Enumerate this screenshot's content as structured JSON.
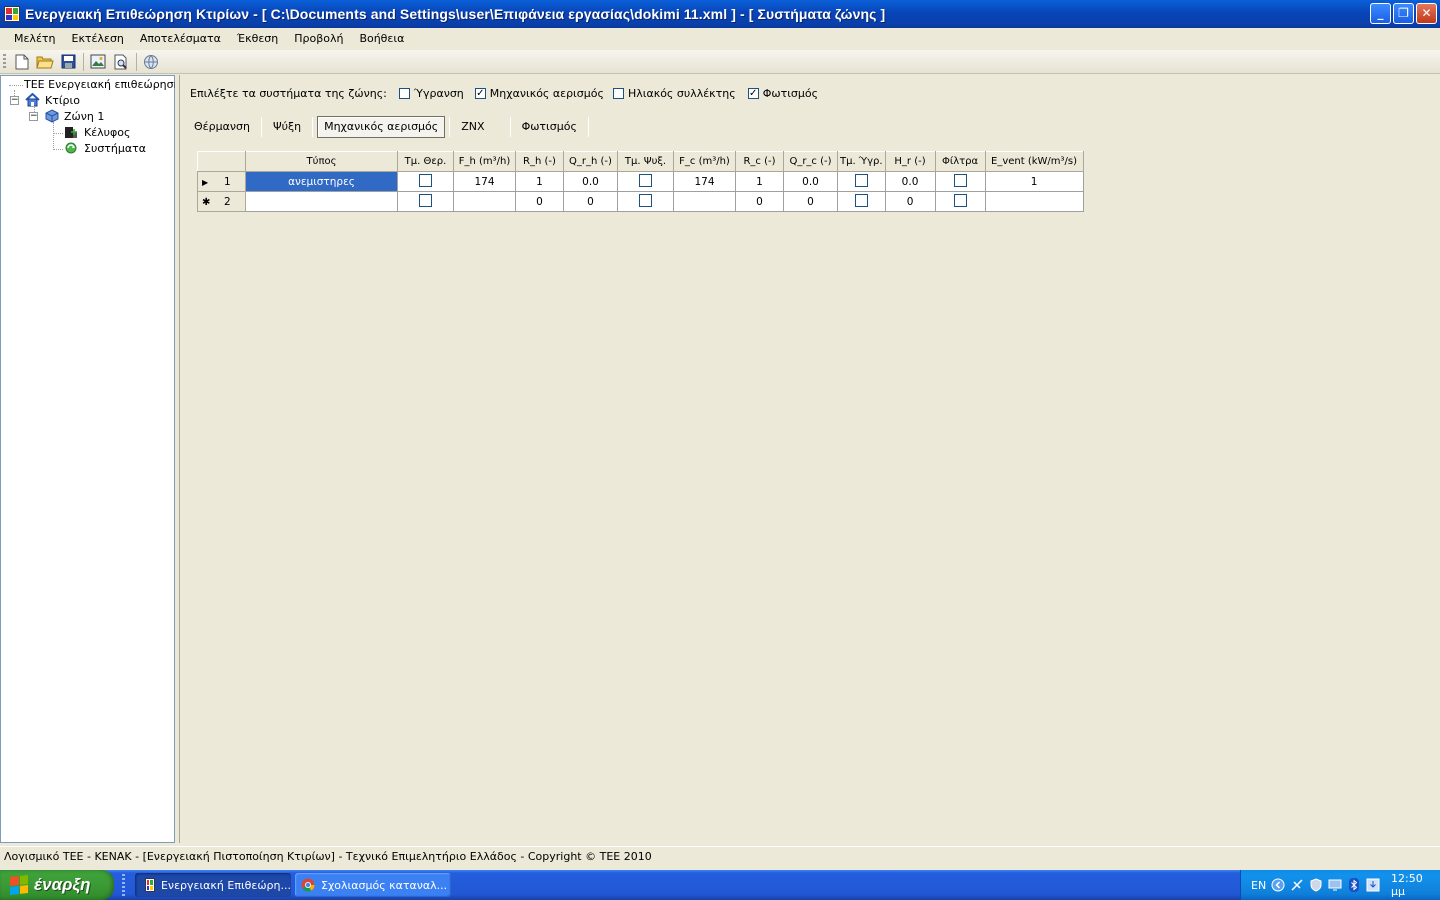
{
  "window": {
    "title": "Ενεργειακή Επιθεώρηση Κτιρίων - [ C:\\Documents and Settings\\user\\Επιφάνεια εργασίας\\dokimi 11.xml ] - [ Συστήματα ζώνης ]",
    "controls": {
      "minimize": "_",
      "maximize": "❐",
      "close": "✕"
    }
  },
  "menu": {
    "items": [
      "Μελέτη",
      "Εκτέλεση",
      "Αποτελέσματα",
      "Έκθεση",
      "Προβολή",
      "Βοήθεια"
    ]
  },
  "toolbar": {
    "buttons": [
      "new-file-icon",
      "open-folder-icon",
      "save-disk-icon",
      "image-icon",
      "print-preview-icon",
      "globe-icon"
    ]
  },
  "tree": {
    "root": "ΤΕΕ  Ενεργειακή επιθεώρηση",
    "building": "Κτίριο",
    "zone": "Ζώνη 1",
    "envelope": "Κέλυφος",
    "systems": "Συστήματα"
  },
  "zone_systems": {
    "label": "Επιλέξτε τα συστήματα της ζώνης:",
    "options": [
      {
        "label": "Ύγρανση",
        "checked": false
      },
      {
        "label": "Μηχανικός αερισμός",
        "checked": true
      },
      {
        "label": "Ηλιακός συλλέκτης",
        "checked": false
      },
      {
        "label": "Φωτισμός",
        "checked": true
      }
    ]
  },
  "tabs": [
    {
      "label": "Θέρμανση",
      "active": false
    },
    {
      "label": "Ψύξη",
      "active": false
    },
    {
      "label": "Μηχανικός αερισμός",
      "active": true
    },
    {
      "label": "ΖΝΧ",
      "active": false
    },
    {
      "label": "Φωτισμός",
      "active": false
    }
  ],
  "grid": {
    "columns": [
      "Τύπος",
      "Τμ. Θερ.",
      "F_h (m³/h)",
      "R_h  (-)",
      "Q_r_h (-)",
      "Τμ. Ψυξ.",
      "F_c (m³/h)",
      "R_c  (-)",
      "Q_r_c (-)",
      "Τμ. Ύγρ.",
      "H_r (-)",
      "Φίλτρα",
      "E_vent (kW/m³/s)"
    ],
    "rows": [
      {
        "marker": "▶",
        "num": "1",
        "type": "ανεμιστηρες",
        "tm_ther": false,
        "f_h": "174",
        "r_h": "1",
        "q_r_h": "0.0",
        "tm_psyx": false,
        "f_c": "174",
        "r_c": "1",
        "q_r_c": "0.0",
        "tm_ygr": false,
        "h_r": "0.0",
        "filtra": false,
        "e_vent": "1"
      },
      {
        "marker": "✱",
        "num": "2",
        "type": "",
        "tm_ther": false,
        "f_h": "",
        "r_h": "0",
        "q_r_h": "0",
        "tm_psyx": false,
        "f_c": "",
        "r_c": "0",
        "q_r_c": "0",
        "tm_ygr": false,
        "h_r": "0",
        "filtra": false,
        "e_vent": ""
      }
    ]
  },
  "status": {
    "text": "Λογισμικό ΤΕΕ - ΚΕΝΑΚ  -  [Ενεργειακή Πιστοποίηση Κτιρίων]  -  Τεχνικό Επιμελητήριο Ελλάδος  -  Copyright © TEE 2010"
  },
  "taskbar": {
    "start": "έναρξη",
    "tasks": [
      {
        "label": "Ενεργειακή Επιθεώρη...",
        "active": true
      },
      {
        "label": "Σχολιασμός καταναλ...",
        "active": false
      }
    ],
    "tray": {
      "lang": "EN",
      "clock": "12:50 μμ"
    }
  },
  "colors": {
    "titlebar": "#0a4fc9",
    "selection": "#316ac5",
    "face": "#ece9d8"
  }
}
